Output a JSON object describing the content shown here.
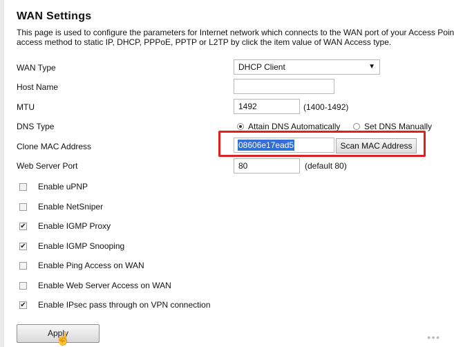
{
  "page": {
    "title": "WAN Settings",
    "description": "This page is used to configure the parameters for Internet network which connects to the WAN port of your Access Point. access method to static IP, DHCP, PPPoE, PPTP or L2TP by click the item value of WAN Access type."
  },
  "form": {
    "wan_type": {
      "label": "WAN Type",
      "value": "DHCP Client",
      "caret": "▼"
    },
    "host_name": {
      "label": "Host Name",
      "value": ""
    },
    "mtu": {
      "label": "MTU",
      "value": "1492",
      "hint": "(1400-1492)"
    },
    "dns_type": {
      "label": "DNS Type",
      "option_auto": "Attain DNS Automatically",
      "option_manual": "Set DNS Manually",
      "selected": "auto"
    },
    "clone_mac": {
      "label": "Clone MAC Address",
      "value": "08606e17ead5",
      "scan_button": "Scan MAC Address"
    },
    "web_server_port": {
      "label": "Web Server Port",
      "value": "80",
      "hint": "(default 80)"
    }
  },
  "options": [
    {
      "label": "Enable uPNP",
      "checked": false
    },
    {
      "label": "Enable NetSniper",
      "checked": false
    },
    {
      "label": "Enable IGMP Proxy",
      "checked": true
    },
    {
      "label": "Enable IGMP Snooping",
      "checked": true
    },
    {
      "label": "Enable Ping Access on WAN",
      "checked": false
    },
    {
      "label": "Enable Web Server Access on WAN",
      "checked": false
    },
    {
      "label": "Enable IPsec pass through on VPN connection",
      "checked": true
    }
  ],
  "actions": {
    "apply_label": "Apply"
  },
  "colors": {
    "highlight": "#e01f1f",
    "selection": "#2f6fd6"
  },
  "icons": {
    "cursor": "hand-cursor-icon",
    "check": "checkmark-icon"
  }
}
